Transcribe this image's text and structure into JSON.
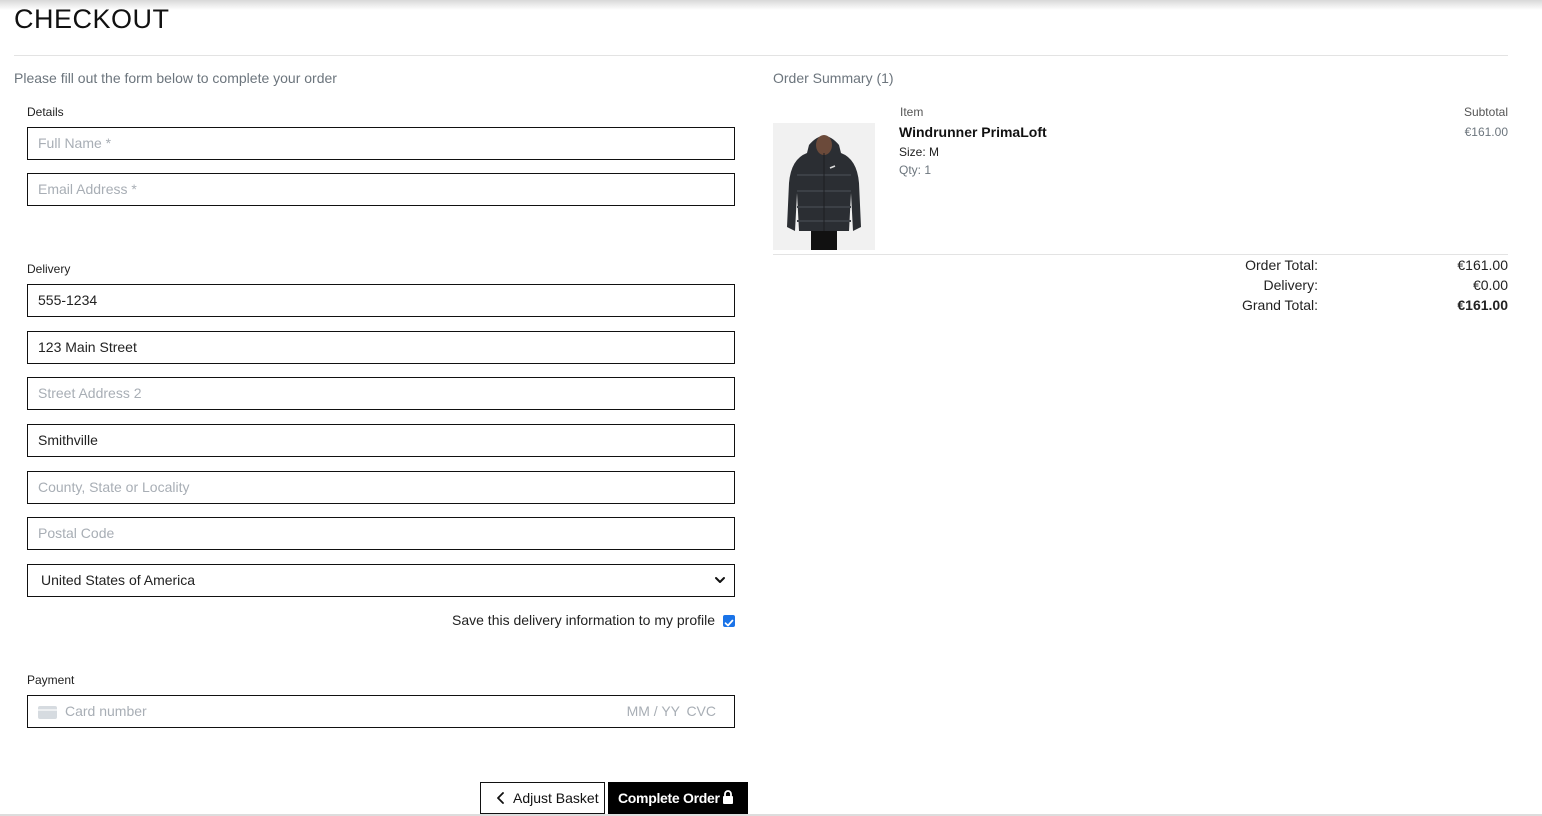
{
  "page": {
    "title": "CHECKOUT"
  },
  "form": {
    "intro": "Please fill out the form below to complete your order",
    "details_legend": "Details",
    "full_name_placeholder": "Full Name *",
    "email_placeholder": "Email Address *",
    "delivery_legend": "Delivery",
    "phone_value": "555-1234",
    "street1_value": "123 Main Street",
    "street2_placeholder": "Street Address 2",
    "town_value": "Smithville",
    "county_placeholder": "County, State or Locality",
    "postcode_placeholder": "Postal Code",
    "country_value": "United States of America",
    "save_info_label": "Save this delivery information to my profile",
    "save_info_checked": true,
    "payment_legend": "Payment",
    "card_number_placeholder": "Card number",
    "card_expiry_placeholder": "MM / YY",
    "card_cvc_placeholder": "CVC"
  },
  "buttons": {
    "adjust_basket": "Adjust Basket",
    "complete_order": "Complete Order"
  },
  "summary": {
    "heading": "Order Summary (1)",
    "col_item": "Item",
    "col_subtotal": "Subtotal",
    "items": [
      {
        "name": "Windrunner PrimaLoft",
        "size": "Size: M",
        "qty": "Qty: 1",
        "subtotal": "€161.00"
      }
    ],
    "order_total_label": "Order Total:",
    "order_total": "€161.00",
    "delivery_label": "Delivery:",
    "delivery": "€0.00",
    "grand_total_label": "Grand Total:",
    "grand_total": "€161.00"
  },
  "icons": {
    "chevron_down": "chevron-down-icon",
    "chevron_left": "chevron-left-icon",
    "lock": "lock-icon",
    "card": "credit-card-icon"
  },
  "colors": {
    "checkbox": "#1a73e8",
    "primary_button": "#000000",
    "placeholder": "#a8aeb5"
  }
}
